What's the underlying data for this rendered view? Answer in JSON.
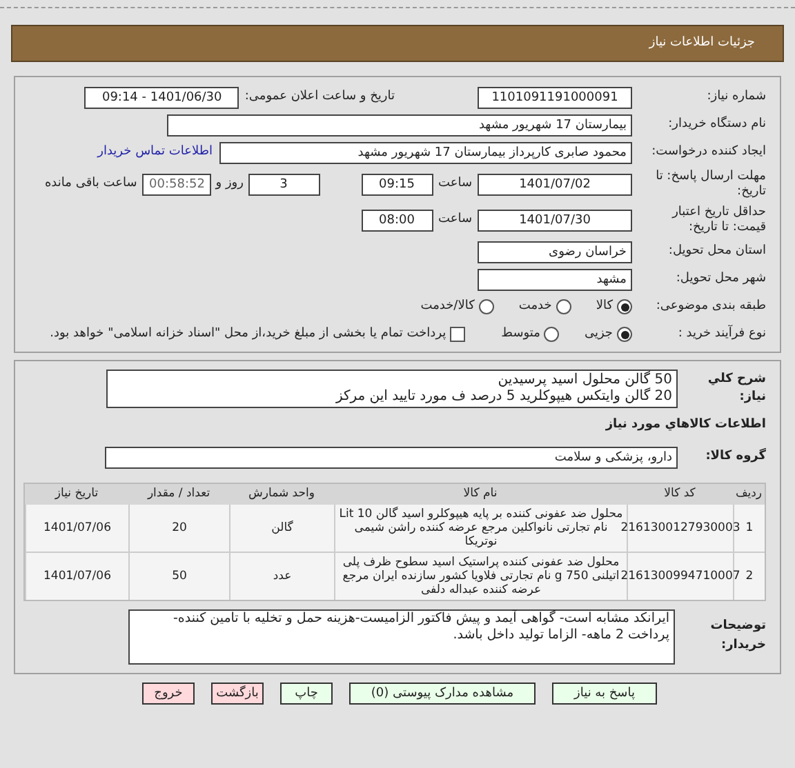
{
  "header": {
    "title": "جزئیات اطلاعات نیاز"
  },
  "need_number": {
    "label": "شماره نیاز:",
    "value": "1101091191000091"
  },
  "announce": {
    "label": "تاریخ و ساعت اعلان عمومی:",
    "value": "1401/06/30 - 09:14"
  },
  "buyer": {
    "label": "نام دستگاه خریدار:",
    "value": "بیمارستان 17 شهریور مشهد"
  },
  "creator": {
    "label": "ایجاد کننده درخواست:",
    "value": "محمود صابری کارپرداز بیمارستان 17 شهریور مشهد",
    "link": "اطلاعات تماس خریدار"
  },
  "deadline": {
    "label": "مهلت ارسال پاسخ: تا تاریخ:",
    "date": "1401/07/02",
    "time_label": "ساعت",
    "time": "09:15",
    "days": "3",
    "days_label": "روز و",
    "remaining": "00:58:52",
    "remaining_label": "ساعت باقی مانده"
  },
  "validity": {
    "label": "حداقل تاریخ اعتبار قیمت: تا تاریخ:",
    "date": "1401/07/30",
    "time_label": "ساعت",
    "time": "08:00"
  },
  "province": {
    "label": "استان محل تحویل:",
    "value": "خراسان رضوی"
  },
  "city": {
    "label": "شهر محل تحویل:",
    "value": "مشهد"
  },
  "category": {
    "label": "طبقه بندی موضوعی:",
    "options": [
      {
        "label": "کالا",
        "selected": true
      },
      {
        "label": "خدمت",
        "selected": false
      },
      {
        "label": "کالا/خدمت",
        "selected": false
      }
    ]
  },
  "process": {
    "label": "نوع فرآیند خرید :",
    "options": [
      {
        "label": "جزیی",
        "selected": true
      },
      {
        "label": "متوسط",
        "selected": false
      }
    ],
    "payment_checkbox": {
      "label": "پرداخت تمام یا بخشی از مبلغ خرید،از محل \"اسناد خزانه اسلامی\" خواهد بود.",
      "checked": false
    }
  },
  "summary": {
    "label": "شرح کلي نياز:",
    "lines": [
      "50 گالن محلول اسید پرسیدین",
      "20 گالن وایتکس هیپوکلرید 5 درصد ف مورد تایید این مرکز"
    ]
  },
  "items_heading": "اطلاعات کالاهاي مورد نياز",
  "group": {
    "label": "گروه کالا:",
    "value": "دارو، پزشکی و سلامت"
  },
  "table": {
    "columns": [
      "ردیف",
      "کد کالا",
      "نام کالا",
      "واحد شمارش",
      "تعداد / مقدار",
      "تاریخ نیاز"
    ],
    "rows": [
      [
        "1",
        "2161300127930003",
        "محلول ضد عفونی کننده بر پایه هیپوکلرو اسید گالن 10 Lit نام تجارتی نانواکلین مرجع عرضه کننده راشن شیمی نوتریکا",
        "گالن",
        "20",
        "1401/07/06"
      ],
      [
        "2",
        "2161300994710007",
        "محلول ضد عفونی کننده پراستیک اسید سطوح ظرف پلی اتیلنی 750 g نام تجارتی فلاویا کشور سازنده ایران مرجع عرضه کننده عبداله دلفی",
        "عدد",
        "50",
        "1401/07/06"
      ]
    ]
  },
  "notes": {
    "label": "توضیحات خریدار:",
    "value": "ایرانکد مشابه است- گواهی آیمد و پیش فاکتور الزامیست-هزینه حمل و تخلیه با تامین کننده-پرداخت 2 ماهه- الزاما تولید داخل باشد."
  },
  "buttons": [
    {
      "label": "پاسخ به نیاز",
      "kind": "primary"
    },
    {
      "label": "مشاهده مدارک پیوستی (0)",
      "kind": "primary"
    },
    {
      "label": "چاپ",
      "kind": "primary"
    },
    {
      "label": "بازگشت",
      "kind": "danger"
    },
    {
      "label": "خروج",
      "kind": "danger"
    }
  ]
}
